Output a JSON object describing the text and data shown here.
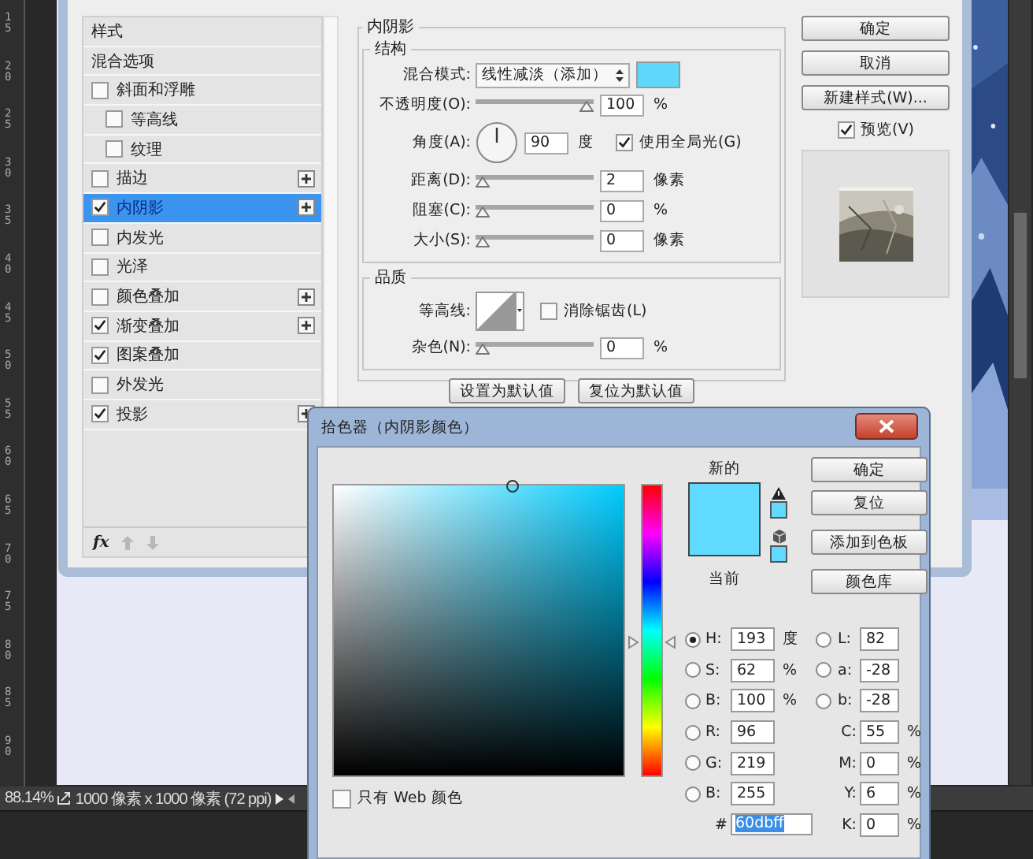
{
  "ruler": {
    "labels": [
      "15",
      "20",
      "25",
      "30",
      "35",
      "40",
      "45",
      "50",
      "55",
      "60",
      "65",
      "70",
      "75",
      "80",
      "85",
      "90"
    ]
  },
  "layer_style": {
    "styles": [
      {
        "label": "样式",
        "kind": "header",
        "selected": false
      },
      {
        "label": "混合选项",
        "kind": "header",
        "selected": false
      },
      {
        "label": "斜面和浮雕",
        "kind": "checkbox",
        "checked": false,
        "selected": false,
        "add_button": false,
        "children": [
          {
            "label": "等高线",
            "kind": "checkbox",
            "checked": false,
            "selected": false,
            "add_button": false
          },
          {
            "label": "纹理",
            "kind": "checkbox",
            "checked": false,
            "selected": false,
            "add_button": false
          }
        ]
      },
      {
        "label": "描边",
        "kind": "checkbox",
        "checked": false,
        "selected": false,
        "add_button": true
      },
      {
        "label": "内阴影",
        "kind": "checkbox",
        "checked": true,
        "selected": true,
        "add_button": true
      },
      {
        "label": "内发光",
        "kind": "checkbox",
        "checked": false,
        "selected": false,
        "add_button": false
      },
      {
        "label": "光泽",
        "kind": "checkbox",
        "checked": false,
        "selected": false,
        "add_button": false
      },
      {
        "label": "颜色叠加",
        "kind": "checkbox",
        "checked": false,
        "selected": false,
        "add_button": true
      },
      {
        "label": "渐变叠加",
        "kind": "checkbox",
        "checked": true,
        "selected": false,
        "add_button": true
      },
      {
        "label": "图案叠加",
        "kind": "checkbox",
        "checked": true,
        "selected": false,
        "add_button": false
      },
      {
        "label": "外发光",
        "kind": "checkbox",
        "checked": false,
        "selected": false,
        "add_button": false
      },
      {
        "label": "投影",
        "kind": "checkbox",
        "checked": true,
        "selected": false,
        "add_button": true
      }
    ],
    "footer": {
      "fx": "fx"
    },
    "panel_title": "内阴影",
    "structure": {
      "title": "结构",
      "blend_mode": {
        "label": "混合模式:",
        "value": "线性减淡（添加）",
        "color": "#5fd8fb"
      },
      "opacity": {
        "label": "不透明度(O):",
        "level": 1.0,
        "value": "100",
        "unit": "%"
      },
      "angle": {
        "label": "角度(A):",
        "value": "90",
        "unit": "度",
        "global_light": {
          "label": "使用全局光(G)",
          "checked": true
        }
      },
      "sliders": [
        {
          "label": "距离(D):",
          "level": 0.0,
          "value": "2",
          "unit": "像素"
        },
        {
          "label": "阻塞(C):",
          "level": 0.0,
          "value": "0",
          "unit": "%"
        },
        {
          "label": "大小(S):",
          "level": 0.0,
          "value": "0",
          "unit": "像素"
        }
      ]
    },
    "quality": {
      "title": "品质",
      "contour": {
        "label": "等高线:",
        "anti_alias": {
          "label": "消除锯齿(L)",
          "checked": false
        }
      },
      "noise": {
        "label": "杂色(N):",
        "level": 0.0,
        "value": "0",
        "unit": "%"
      }
    },
    "default_buttons": [
      "设置为默认值",
      "复位为默认值"
    ],
    "buttons": [
      "确定",
      "取消",
      "新建样式(W)..."
    ],
    "preview": {
      "label": "预览(V)",
      "checked": true
    }
  },
  "color_picker": {
    "title": "拾色器（内阴影颜色）",
    "field_marker": {
      "level": 0.62
    },
    "hue_slider": {
      "level": 0.46
    },
    "new": {
      "label": "新的",
      "color": "#60dbff"
    },
    "current": {
      "label": "当前",
      "color": "#60dbff"
    },
    "buttons": [
      "确定",
      "复位",
      "添加到色板",
      "颜色库"
    ],
    "left_fields": [
      {
        "label": "H:",
        "value": "193",
        "unit": "度",
        "selected": true
      },
      {
        "label": "S:",
        "value": "62",
        "unit": "%",
        "selected": false
      },
      {
        "label": "B:",
        "value": "100",
        "unit": "%",
        "selected": false
      },
      {
        "label": "R:",
        "value": "96",
        "selected": false
      },
      {
        "label": "G:",
        "value": "219",
        "selected": false
      },
      {
        "label": "B:",
        "value": "255",
        "selected": false
      }
    ],
    "right_fields": [
      {
        "kind": "radio",
        "label": "L:",
        "value": "82",
        "selected": false
      },
      {
        "kind": "radio",
        "label": "a:",
        "value": "-28",
        "selected": false
      },
      {
        "kind": "radio",
        "label": "b:",
        "value": "-28",
        "selected": false
      },
      {
        "kind": "plain",
        "label": "C:",
        "value": "55",
        "unit": "%"
      },
      {
        "kind": "plain",
        "label": "M:",
        "value": "0",
        "unit": "%"
      },
      {
        "kind": "plain",
        "label": "Y:",
        "value": "6",
        "unit": "%"
      },
      {
        "kind": "plain",
        "label": "K:",
        "value": "0",
        "unit": "%"
      }
    ],
    "hex": {
      "label": "#",
      "value": "60dbff"
    },
    "web_only": {
      "label": "只有 Web 颜色",
      "checked": false
    }
  },
  "status_bar": {
    "zoom": "88.14%",
    "doc_info": "1000 像素 x 1000 像素 (72 ppi)"
  }
}
